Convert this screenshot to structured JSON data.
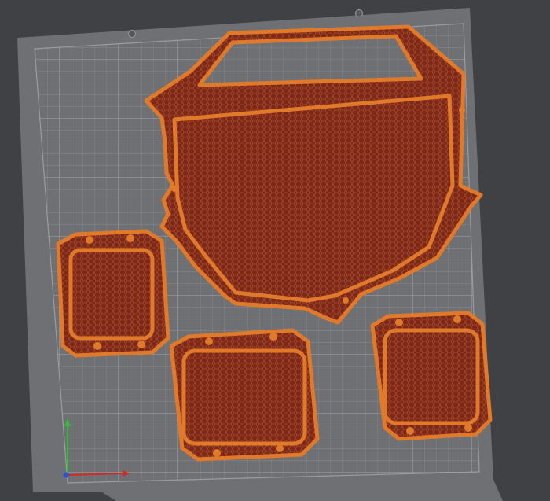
{
  "viewport": {
    "background": "#3f4144",
    "bed_color": "#6e7073",
    "grid_color": "#8d8f92",
    "grid_major_color": "#a2a4a6"
  },
  "axes": {
    "x_color": "#d22a2a",
    "y_color": "#2fbf3a",
    "z_color": "#2f52d8"
  },
  "parts": {
    "wall_color": "#e07a2a",
    "infill_color": "#7d2818",
    "infill_line_color": "#a54a2a",
    "count": 4
  }
}
